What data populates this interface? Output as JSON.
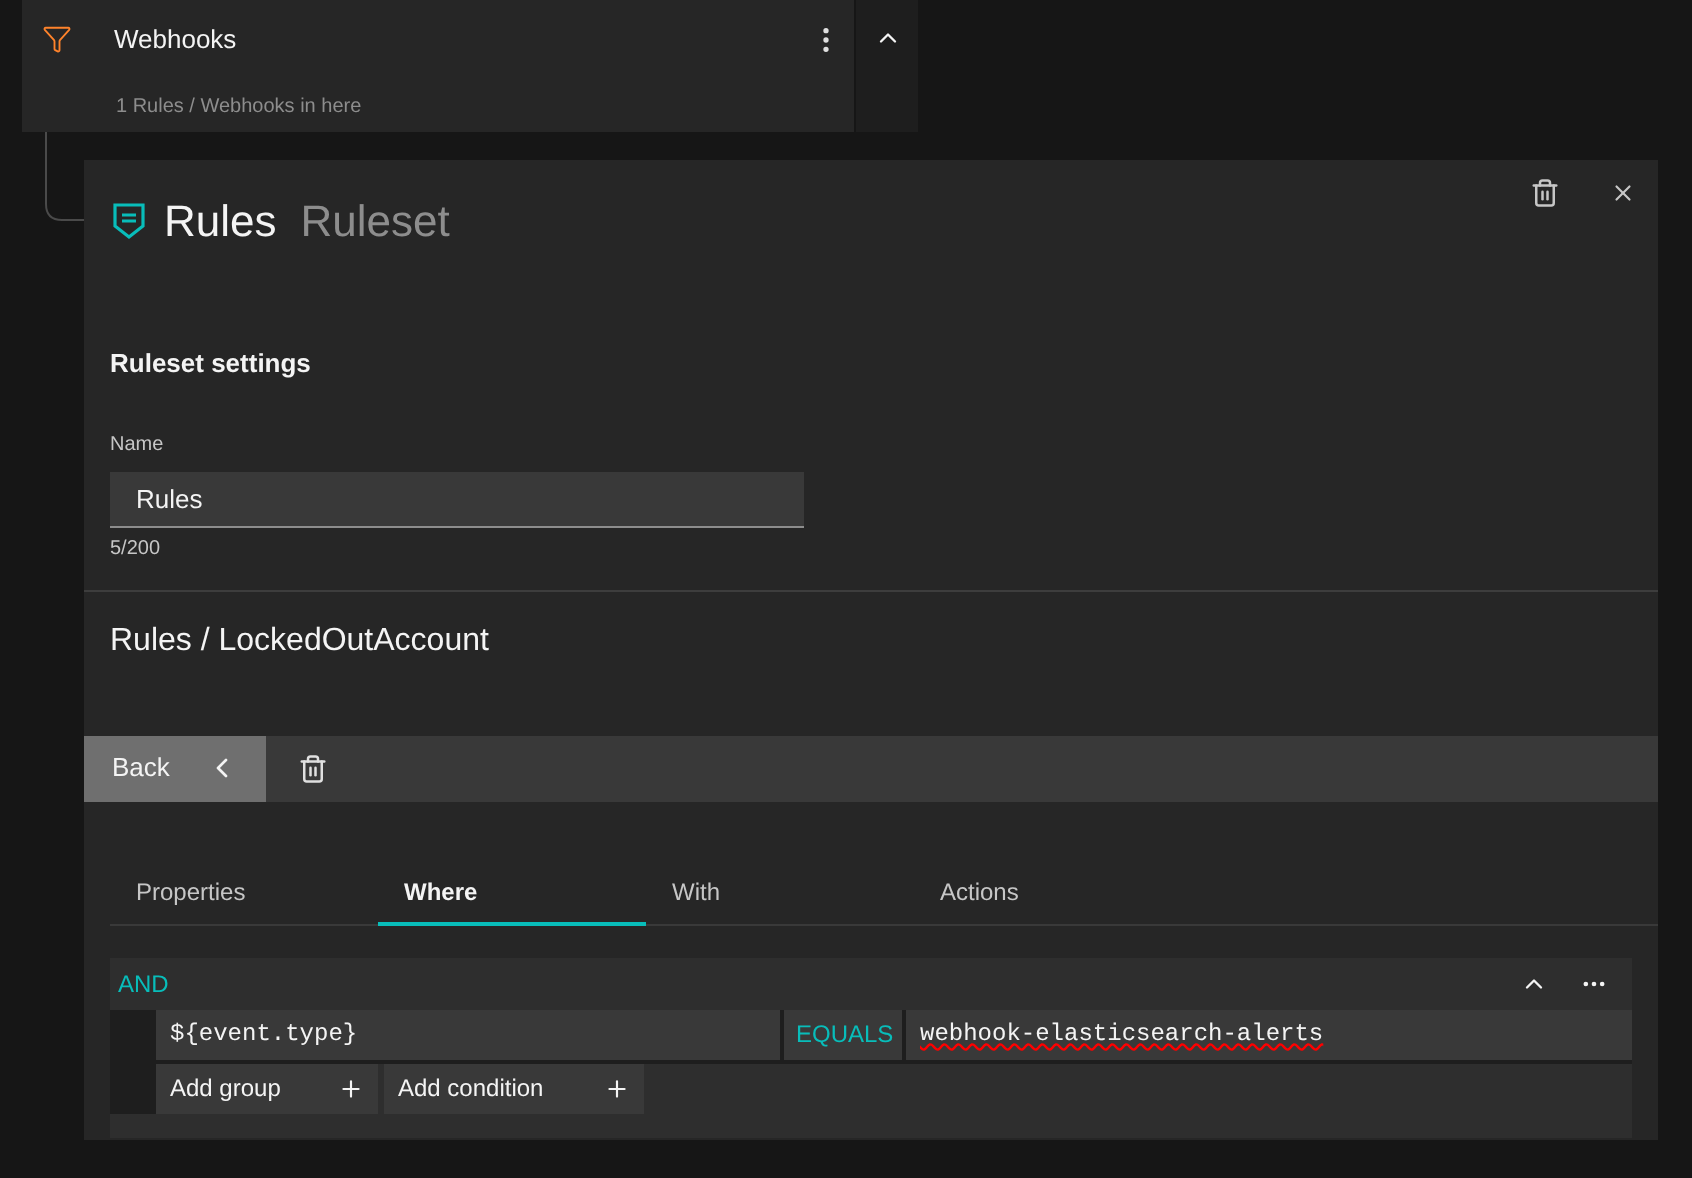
{
  "group_card": {
    "title": "Webhooks",
    "subtitle": "1 Rules / Webhooks in here",
    "expanded": true
  },
  "panel": {
    "title": "Rules",
    "type_label": "Ruleset"
  },
  "settings": {
    "heading": "Ruleset settings",
    "name_label": "Name",
    "name_value": "Rules",
    "counter": "5/200"
  },
  "rule": {
    "path": "Rules / LockedOutAccount"
  },
  "toolbar": {
    "back": "Back"
  },
  "tabs": [
    {
      "label": "Properties",
      "selected": false
    },
    {
      "label": "Where",
      "selected": true
    },
    {
      "label": "With",
      "selected": false
    },
    {
      "label": "Actions",
      "selected": false
    }
  ],
  "condition_group": {
    "operator": "AND",
    "expanded": true,
    "conditions": [
      {
        "field": "${event.type}",
        "comparator": "EQUALS",
        "value": "webhook-elasticsearch-alerts",
        "spell_error": true
      }
    ],
    "add_buttons": [
      "Add group",
      "Add condition"
    ]
  }
}
